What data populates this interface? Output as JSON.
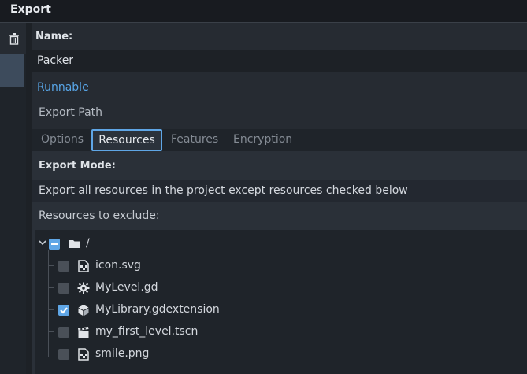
{
  "window": {
    "title": "Export"
  },
  "preset": {
    "name_label": "Name:",
    "name_value": "Packer",
    "runnable_label": "Runnable",
    "export_path_label": "Export Path"
  },
  "tabs": [
    {
      "label": "Options",
      "active": false
    },
    {
      "label": "Resources",
      "active": true
    },
    {
      "label": "Features",
      "active": false
    },
    {
      "label": "Encryption",
      "active": false
    }
  ],
  "resources": {
    "export_mode_label": "Export Mode:",
    "export_mode_value": "Export all resources in the project except resources checked below",
    "exclude_label": "Resources to exclude:",
    "root": {
      "label": "/",
      "state": "indeterminate",
      "expanded": true,
      "icon": "folder-icon"
    },
    "files": [
      {
        "label": "icon.svg",
        "checked": false,
        "icon": "image-file-icon"
      },
      {
        "label": "MyLevel.gd",
        "checked": false,
        "icon": "gear-script-icon"
      },
      {
        "label": "MyLibrary.gdextension",
        "checked": true,
        "icon": "cube-extension-icon"
      },
      {
        "label": "my_first_level.tscn",
        "checked": false,
        "icon": "clapperboard-scene-icon"
      },
      {
        "label": "smile.png",
        "checked": false,
        "icon": "image-file-icon"
      }
    ]
  },
  "colors": {
    "accent": "#5fa6e6",
    "link": "#58a6e8",
    "background": "#1d2126",
    "panel": "#262b32"
  }
}
